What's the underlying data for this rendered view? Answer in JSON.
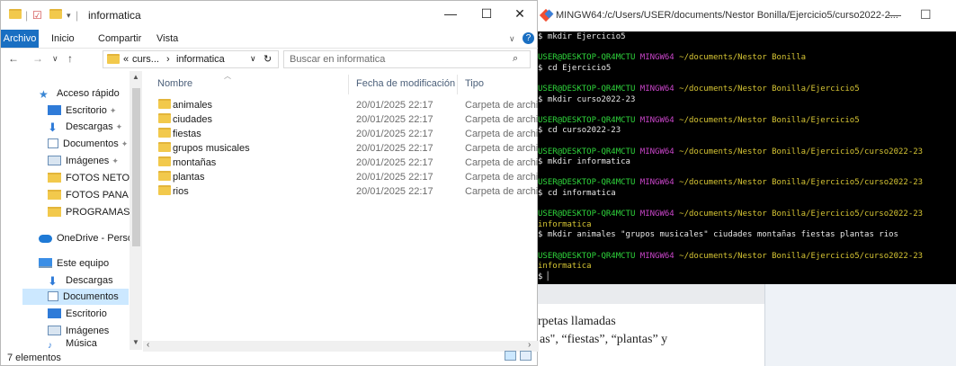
{
  "document": {
    "text_line1": "rpetas llamadas",
    "text_line2": "as\", “fiestas”, “plantas” y"
  },
  "explorer": {
    "title": "informatica",
    "window_controls": {
      "minimize": "—",
      "maximize": "☐",
      "close": "✕"
    },
    "ribbon_tabs": [
      "Archivo",
      "Inicio",
      "Compartir",
      "Vista"
    ],
    "address": {
      "prefix": "«",
      "crumb1": "curs...",
      "separator": "›",
      "crumb2": "informatica"
    },
    "search_placeholder": "Buscar en informatica",
    "nav_items": [
      {
        "label": "Acceso rápido",
        "icon": "star-icon"
      },
      {
        "label": "Escritorio",
        "icon": "desktop-icon"
      },
      {
        "label": "Descargas",
        "icon": "download-icon"
      },
      {
        "label": "Documentos",
        "icon": "documents-icon"
      },
      {
        "label": "Imágenes",
        "icon": "images-icon"
      },
      {
        "label": "FOTOS NETO",
        "icon": "folder-icon"
      },
      {
        "label": "FOTOS PANA",
        "icon": "folder-icon"
      },
      {
        "label": "PROGRAMAS",
        "icon": "folder-icon"
      },
      {
        "label": "OneDrive - Persor",
        "icon": "onedrive-icon"
      },
      {
        "label": "Este equipo",
        "icon": "computer-icon"
      },
      {
        "label": "Descargas",
        "icon": "download-icon"
      },
      {
        "label": "Documentos",
        "icon": "documents-icon"
      },
      {
        "label": "Escritorio",
        "icon": "desktop-icon"
      },
      {
        "label": "Imágenes",
        "icon": "images-icon"
      },
      {
        "label": "Música",
        "icon": "music-icon"
      }
    ],
    "columns": {
      "name": "Nombre",
      "date": "Fecha de modificación",
      "type": "Tipo"
    },
    "files": [
      {
        "name": "animales",
        "date": "20/01/2025 22:17",
        "type": "Carpeta de archivos"
      },
      {
        "name": "ciudades",
        "date": "20/01/2025 22:17",
        "type": "Carpeta de archivos"
      },
      {
        "name": "fiestas",
        "date": "20/01/2025 22:17",
        "type": "Carpeta de archivos"
      },
      {
        "name": "grupos musicales",
        "date": "20/01/2025 22:17",
        "type": "Carpeta de archivos"
      },
      {
        "name": "montañas",
        "date": "20/01/2025 22:17",
        "type": "Carpeta de archivos"
      },
      {
        "name": "plantas",
        "date": "20/01/2025 22:17",
        "type": "Carpeta de archivos"
      },
      {
        "name": "rios",
        "date": "20/01/2025 22:17",
        "type": "Carpeta de archivos"
      }
    ],
    "status": "7 elementos"
  },
  "terminal": {
    "title": "MINGW64:/c/Users/USER/documents/Nestor Bonilla/Ejercicio5/curso2022-2...",
    "lines": [
      {
        "kind": "cmd",
        "text": "$ mkdir Ejercicio5"
      },
      {
        "kind": "blank"
      },
      {
        "kind": "prompt",
        "user": "USER@DESKTOP-QR4MCTU",
        "shell": "MINGW64",
        "path": "~/documents/Nestor Bonilla"
      },
      {
        "kind": "cmd",
        "text": "$ cd Ejercicio5"
      },
      {
        "kind": "blank"
      },
      {
        "kind": "prompt",
        "user": "USER@DESKTOP-QR4MCTU",
        "shell": "MINGW64",
        "path": "~/documents/Nestor Bonilla/Ejercicio5"
      },
      {
        "kind": "cmd",
        "text": "$ mkdir curso2022-23"
      },
      {
        "kind": "blank"
      },
      {
        "kind": "prompt",
        "user": "USER@DESKTOP-QR4MCTU",
        "shell": "MINGW64",
        "path": "~/documents/Nestor Bonilla/Ejercicio5"
      },
      {
        "kind": "cmd",
        "text": "$ cd curso2022-23"
      },
      {
        "kind": "blank"
      },
      {
        "kind": "prompt",
        "user": "USER@DESKTOP-QR4MCTU",
        "shell": "MINGW64",
        "path": "~/documents/Nestor Bonilla/Ejercicio5/curso2022-23"
      },
      {
        "kind": "cmd",
        "text": "$ mkdir informatica"
      },
      {
        "kind": "blank"
      },
      {
        "kind": "prompt",
        "user": "USER@DESKTOP-QR4MCTU",
        "shell": "MINGW64",
        "path": "~/documents/Nestor Bonilla/Ejercicio5/curso2022-23"
      },
      {
        "kind": "cmd",
        "text": "$ cd informatica"
      },
      {
        "kind": "blank"
      },
      {
        "kind": "prompt",
        "user": "USER@DESKTOP-QR4MCTU",
        "shell": "MINGW64",
        "path": "~/documents/Nestor Bonilla/Ejercicio5/curso2022-23"
      },
      {
        "kind": "cont",
        "text": "informatica"
      },
      {
        "kind": "cmd",
        "text": "$ mkdir animales \"grupos musicales\" ciudades montañas fiestas plantas rios"
      },
      {
        "kind": "blank"
      },
      {
        "kind": "prompt",
        "user": "USER@DESKTOP-QR4MCTU",
        "shell": "MINGW64",
        "path": "~/documents/Nestor Bonilla/Ejercicio5/curso2022-23"
      },
      {
        "kind": "cont",
        "text": "informatica"
      },
      {
        "kind": "cmd",
        "text": "$ "
      }
    ]
  },
  "colors": {
    "accent": "#1a6fc2",
    "prompt_user": "#2fd63c",
    "prompt_shell": "#c945c9",
    "prompt_path": "#d6c534",
    "selection": "#cce8ff"
  }
}
